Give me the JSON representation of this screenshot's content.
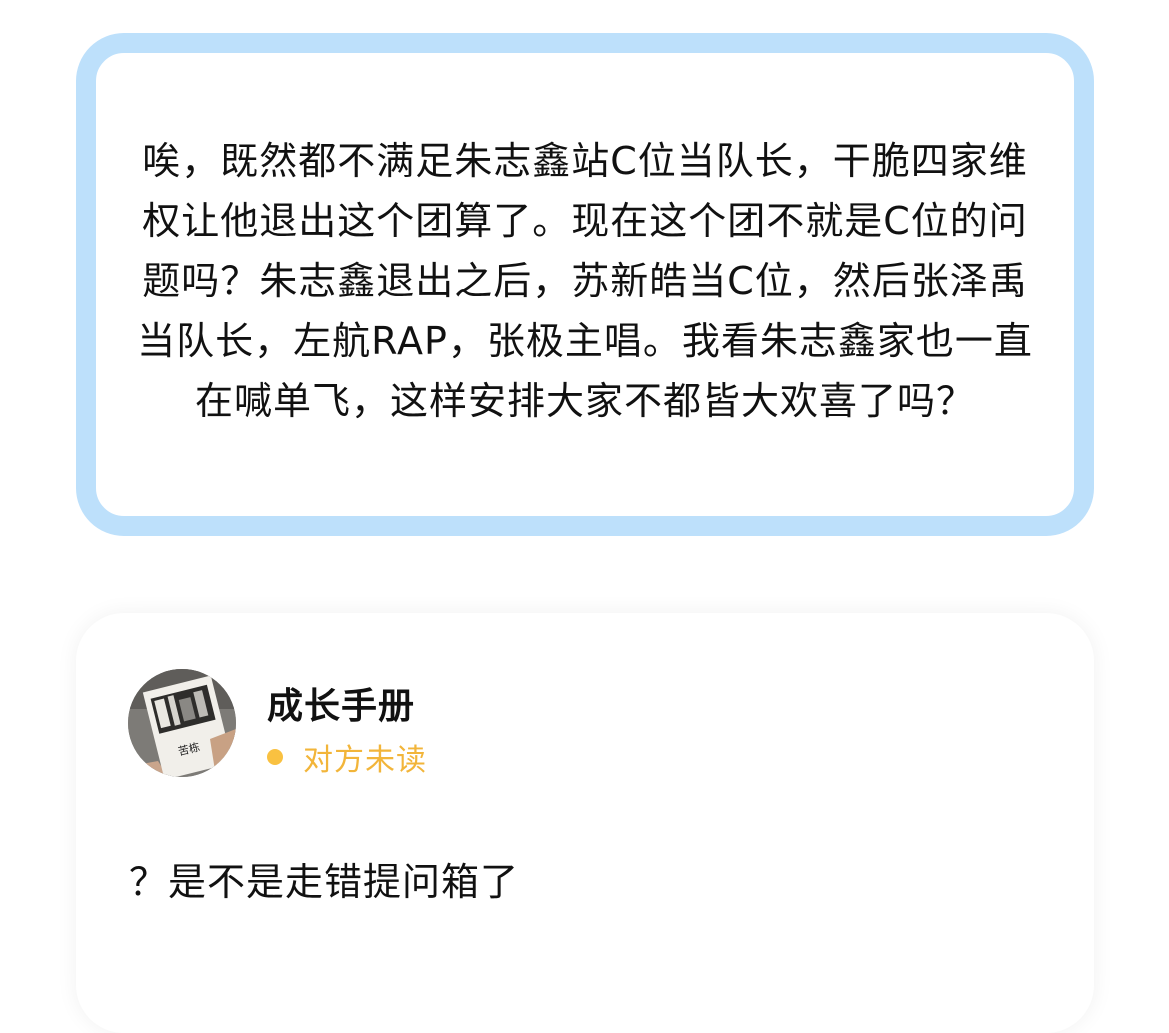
{
  "question": {
    "text": "唉，既然都不满足朱志鑫站C位当队长，干脆四家维权让他退出这个团算了。现在这个团不就是C位的问题吗？朱志鑫退出之后，苏新皓当C位，然后张泽禹当队长，左航RAP，张极主唱。我看朱志鑫家也一直在喊单飞，这样安排大家不都皆大欢喜了吗？",
    "border_color": "#bde0fb"
  },
  "answer": {
    "user": {
      "name": "成长手册",
      "avatar_icon": "book-photo-avatar",
      "avatar_book_title": "苦栋"
    },
    "status": {
      "text": "对方未读",
      "color": "#f2b53a"
    },
    "reply_text": "？是不是走错提问箱了"
  }
}
